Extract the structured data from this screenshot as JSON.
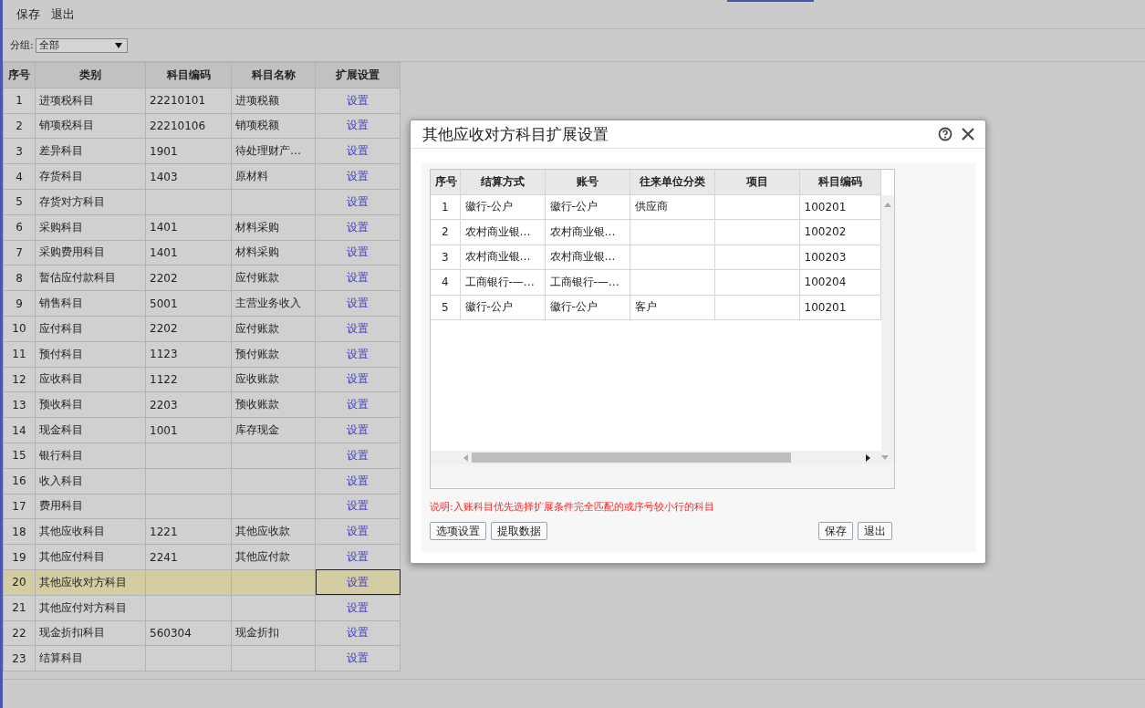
{
  "toolbar": [
    "保存",
    "退出"
  ],
  "filter": {
    "label": "分组:",
    "value": "全部"
  },
  "table": {
    "columns": [
      "序号",
      "类别",
      "科目编码",
      "科目名称",
      "扩展设置"
    ],
    "rows": [
      {
        "no": "1",
        "category": "进项税科目",
        "code": "22210101",
        "name": "进项税额",
        "action": "设置",
        "selected": false
      },
      {
        "no": "2",
        "category": "销项税科目",
        "code": "22210106",
        "name": "销项税额",
        "action": "设置",
        "selected": false
      },
      {
        "no": "3",
        "category": "差异科目",
        "code": "1901",
        "name": "待处理财产…",
        "action": "设置",
        "selected": false
      },
      {
        "no": "4",
        "category": "存货科目",
        "code": "1403",
        "name": "原材料",
        "action": "设置",
        "selected": false
      },
      {
        "no": "5",
        "category": "存货对方科目",
        "code": "",
        "name": "",
        "action": "设置",
        "selected": false
      },
      {
        "no": "6",
        "category": "采购科目",
        "code": "1401",
        "name": "材料采购",
        "action": "设置",
        "selected": false
      },
      {
        "no": "7",
        "category": "采购费用科目",
        "code": "1401",
        "name": "材料采购",
        "action": "设置",
        "selected": false
      },
      {
        "no": "8",
        "category": "暂估应付款科目",
        "code": "2202",
        "name": "应付账款",
        "action": "设置",
        "selected": false
      },
      {
        "no": "9",
        "category": "销售科目",
        "code": "5001",
        "name": "主营业务收入",
        "action": "设置",
        "selected": false
      },
      {
        "no": "10",
        "category": "应付科目",
        "code": "2202",
        "name": "应付账款",
        "action": "设置",
        "selected": false
      },
      {
        "no": "11",
        "category": "预付科目",
        "code": "1123",
        "name": "预付账款",
        "action": "设置",
        "selected": false
      },
      {
        "no": "12",
        "category": "应收科目",
        "code": "1122",
        "name": "应收账款",
        "action": "设置",
        "selected": false
      },
      {
        "no": "13",
        "category": "预收科目",
        "code": "2203",
        "name": "预收账款",
        "action": "设置",
        "selected": false
      },
      {
        "no": "14",
        "category": "现金科目",
        "code": "1001",
        "name": "库存现金",
        "action": "设置",
        "selected": false
      },
      {
        "no": "15",
        "category": "银行科目",
        "code": "",
        "name": "",
        "action": "设置",
        "selected": false
      },
      {
        "no": "16",
        "category": "收入科目",
        "code": "",
        "name": "",
        "action": "设置",
        "selected": false
      },
      {
        "no": "17",
        "category": "费用科目",
        "code": "",
        "name": "",
        "action": "设置",
        "selected": false
      },
      {
        "no": "18",
        "category": "其他应收科目",
        "code": "1221",
        "name": "其他应收款",
        "action": "设置",
        "selected": false
      },
      {
        "no": "19",
        "category": "其他应付科目",
        "code": "2241",
        "name": "其他应付款",
        "action": "设置",
        "selected": false
      },
      {
        "no": "20",
        "category": "其他应收对方科目",
        "code": "",
        "name": "",
        "action": "设置",
        "selected": true
      },
      {
        "no": "21",
        "category": "其他应付对方科目",
        "code": "",
        "name": "",
        "action": "设置",
        "selected": false
      },
      {
        "no": "22",
        "category": "现金折扣科目",
        "code": "560304",
        "name": "现金折扣",
        "action": "设置",
        "selected": false
      },
      {
        "no": "23",
        "category": "结算科目",
        "code": "",
        "name": "",
        "action": "设置",
        "selected": false
      }
    ]
  },
  "dialog": {
    "title": "其他应收对方科目扩展设置",
    "columns": [
      "序号",
      "结算方式",
      "账号",
      "往来单位分类",
      "项目",
      "科目编码"
    ],
    "rows": [
      [
        "1",
        "徽行-公户",
        "徽行-公户",
        "供应商",
        "",
        "100201"
      ],
      [
        "2",
        "农村商业银…",
        "农村商业银…",
        "",
        "",
        "100202"
      ],
      [
        "3",
        "农村商业银…",
        "农村商业银…",
        "",
        "",
        "100203"
      ],
      [
        "4",
        "工商银行-—…",
        "工商银行-—…",
        "",
        "",
        "100204"
      ],
      [
        "5",
        "徽行-公户",
        "徽行-公户",
        "客户",
        "",
        "100201"
      ]
    ],
    "note": "说明:入账科目优先选择扩展条件完全匹配的或序号较小行的科目",
    "left_buttons": [
      "选项设置",
      "提取数据"
    ],
    "right_buttons": [
      "保存",
      "退出"
    ]
  }
}
